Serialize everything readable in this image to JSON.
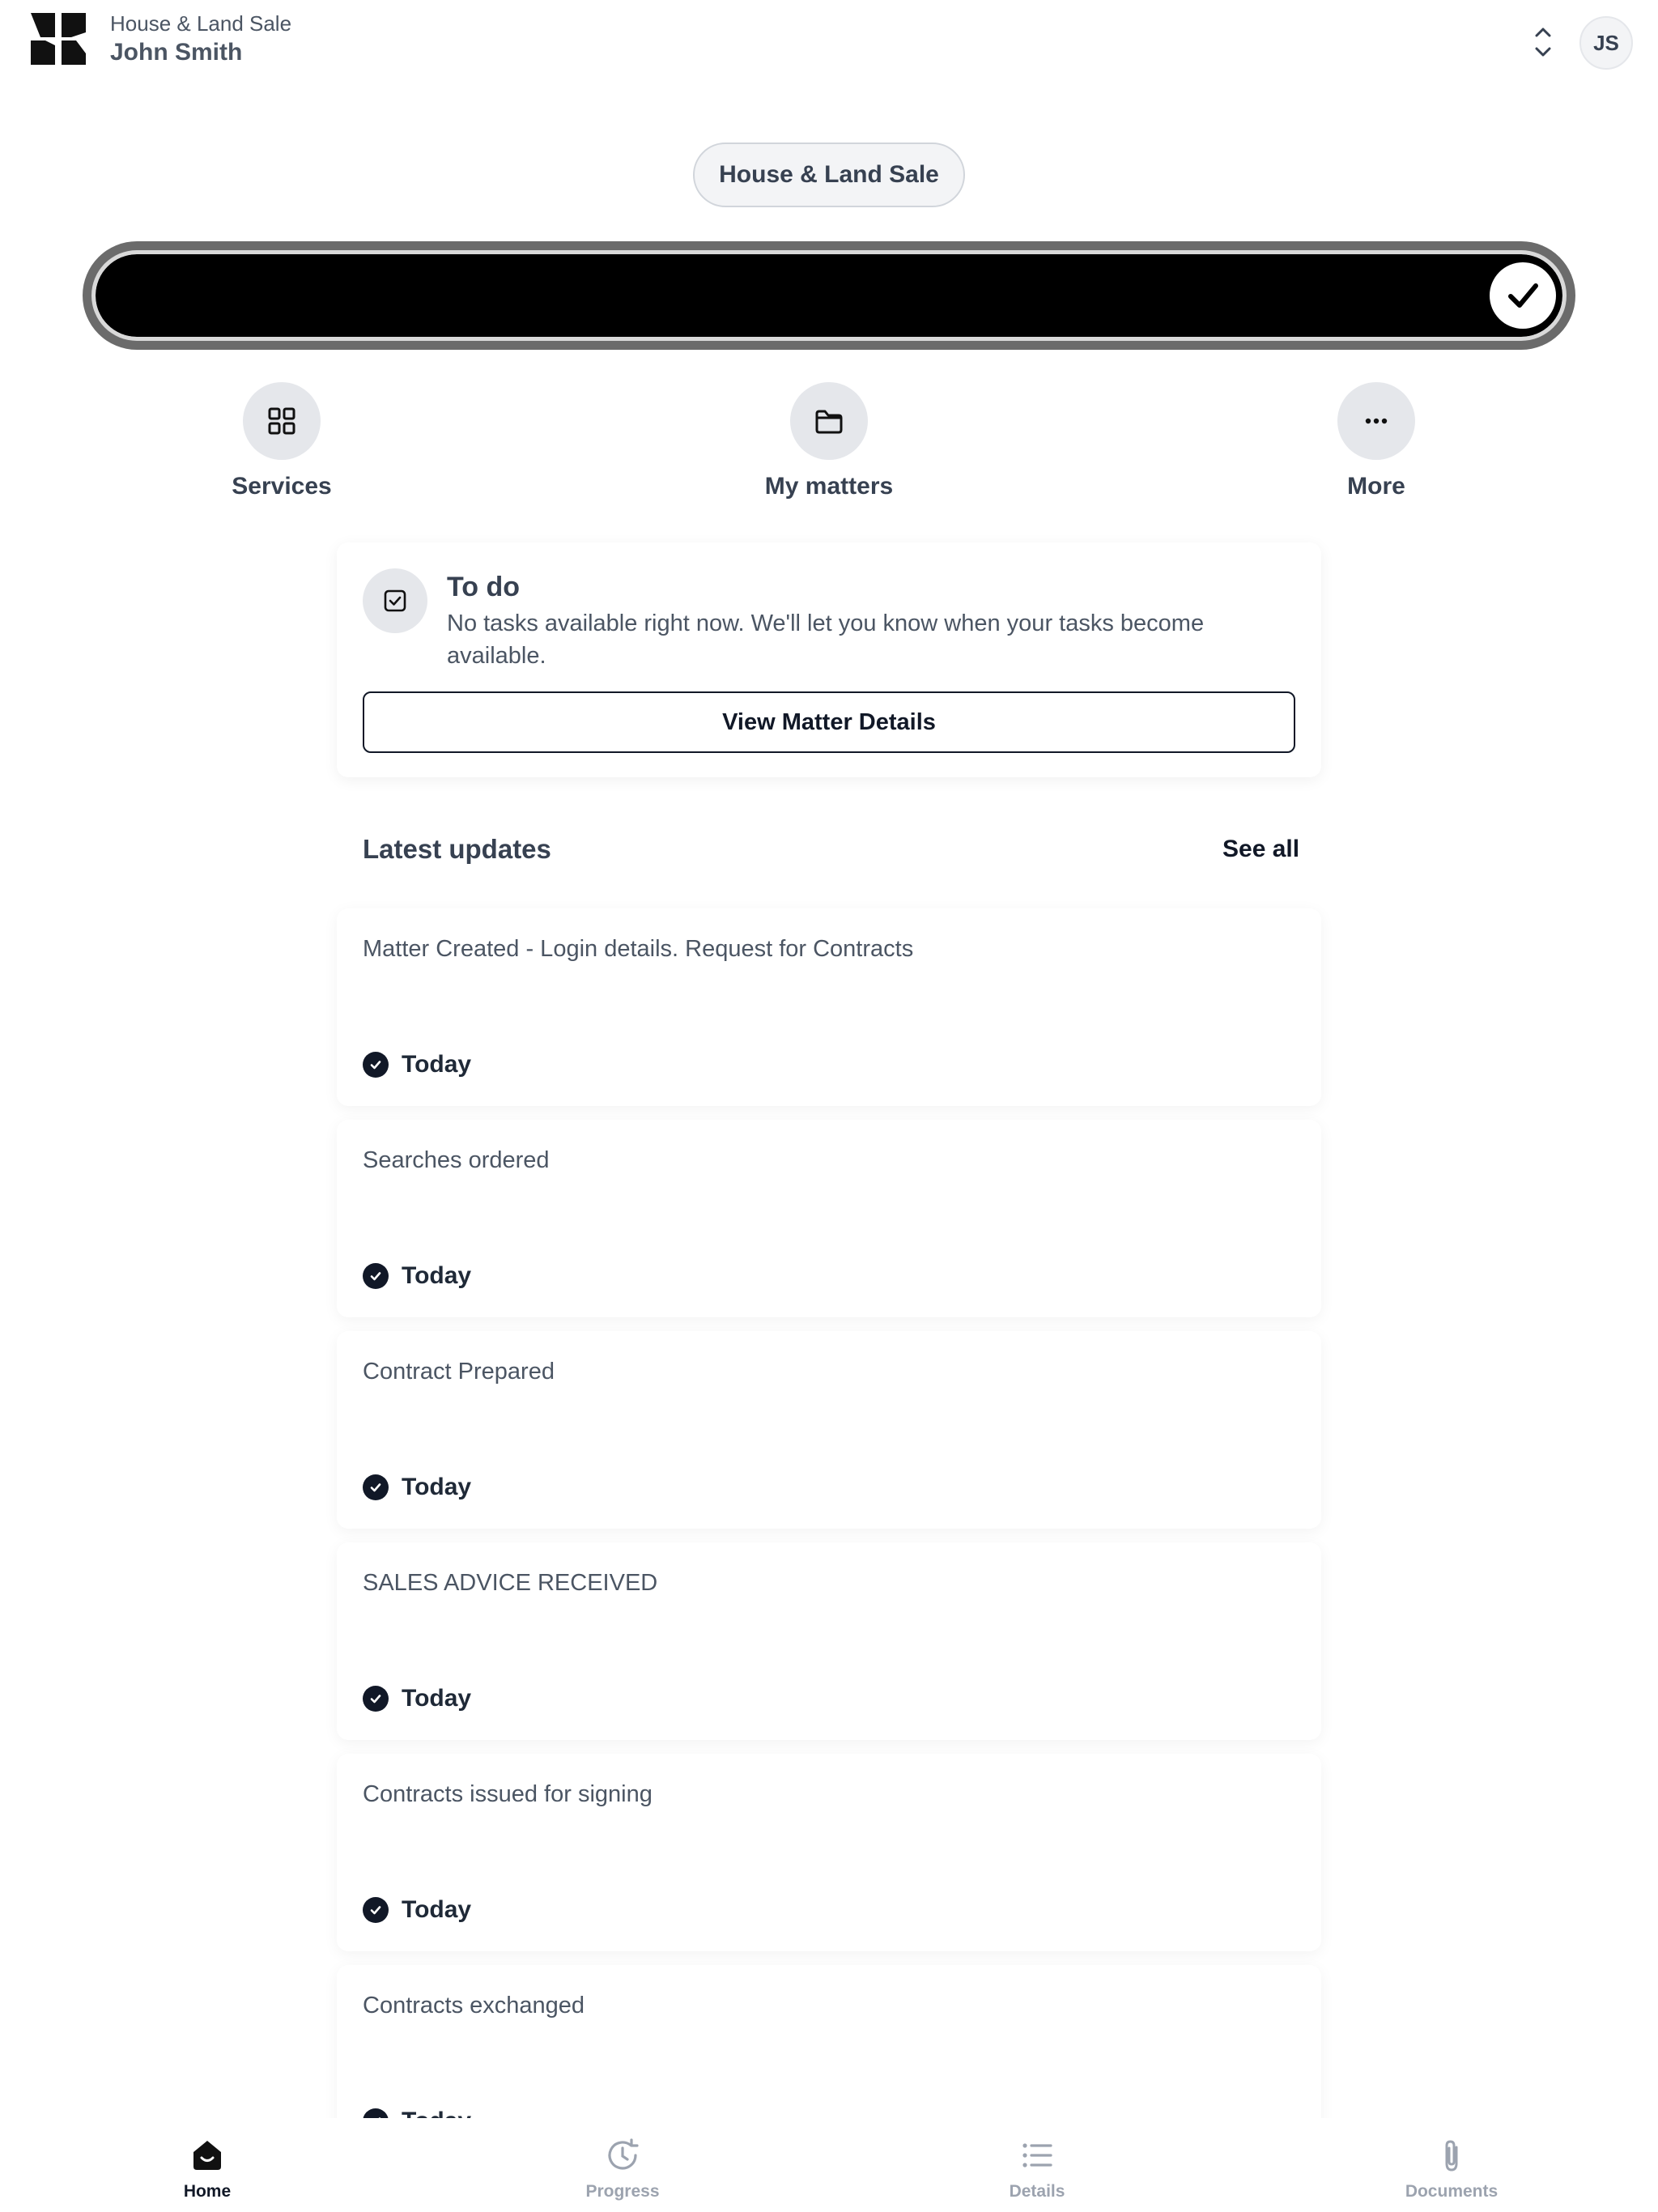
{
  "header": {
    "subtitle": "House & Land Sale",
    "user_name": "John Smith",
    "avatar_initials": "JS",
    "switcher_icon": "chevron-up-down-icon"
  },
  "matter": {
    "pill_label": "House & Land Sale"
  },
  "progress": {
    "percent_complete": 100,
    "fill_color": "#000000",
    "complete_icon": "checkmark-icon"
  },
  "quick_actions": [
    {
      "label": "Services",
      "icon": "grid-icon"
    },
    {
      "label": "My matters",
      "icon": "folder-icon"
    },
    {
      "label": "More",
      "icon": "ellipsis-icon"
    }
  ],
  "todo": {
    "title": "To do",
    "message": "No tasks available right now. We'll let you know when your tasks become available.",
    "button_label": "View Matter Details",
    "icon": "checkbox-icon"
  },
  "updates": {
    "title": "Latest updates",
    "see_all_label": "See all",
    "items": [
      {
        "text": "Matter Created - Login details. Request for Contracts",
        "when": "Today"
      },
      {
        "text": "Searches ordered",
        "when": "Today"
      },
      {
        "text": "Contract Prepared",
        "when": "Today"
      },
      {
        "text": "SALES ADVICE RECEIVED",
        "when": "Today"
      },
      {
        "text": "Contracts issued for signing",
        "when": "Today"
      },
      {
        "text": "Contracts exchanged",
        "when": "Today"
      }
    ]
  },
  "bottom_nav": {
    "active": "Home",
    "items": [
      {
        "label": "Home",
        "icon": "home-icon"
      },
      {
        "label": "Progress",
        "icon": "clock-arrow-icon"
      },
      {
        "label": "Details",
        "icon": "list-icon"
      },
      {
        "label": "Documents",
        "icon": "paperclip-icon"
      }
    ]
  },
  "colors": {
    "text_primary": "#111827",
    "text_secondary": "#4b5563",
    "muted": "#9ca3af",
    "chip_bg": "#e5e7eb"
  }
}
